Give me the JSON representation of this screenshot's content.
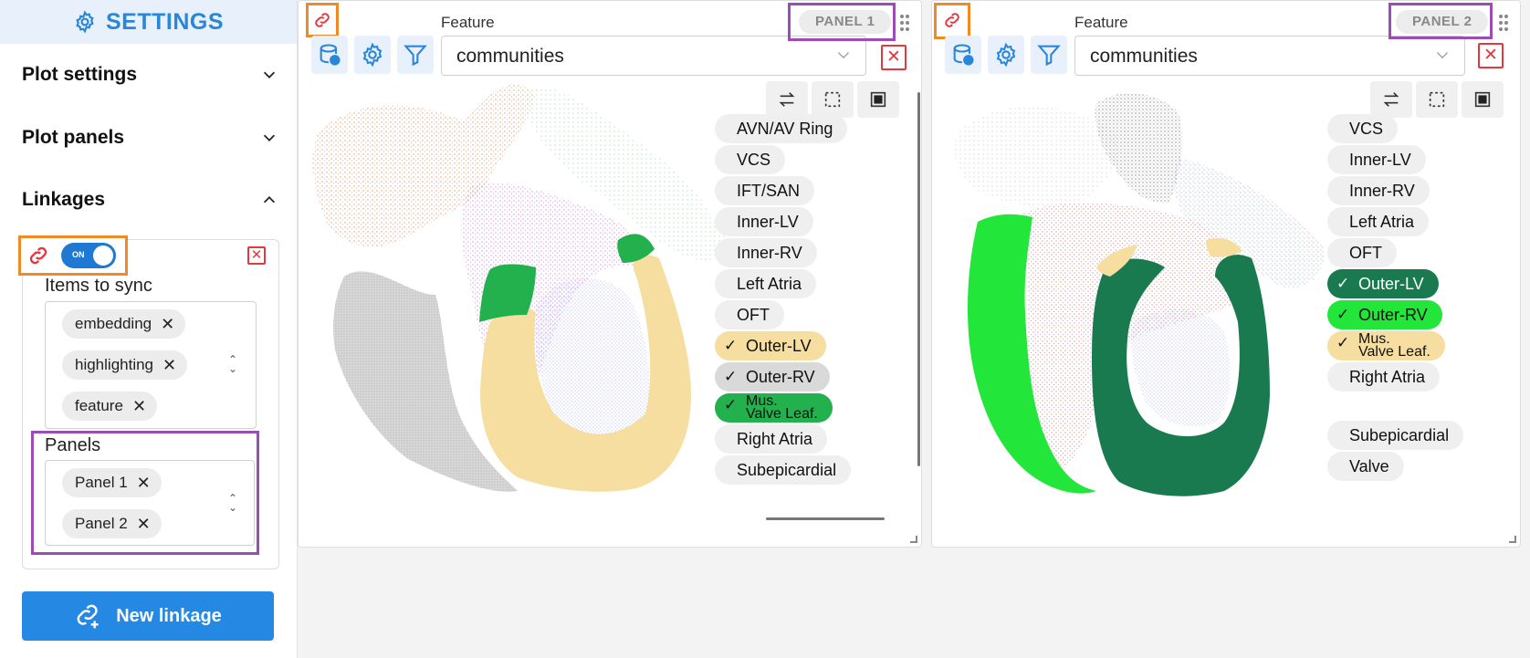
{
  "sidebar": {
    "title": "SETTINGS",
    "sections": [
      {
        "label": "Plot settings",
        "expanded": false
      },
      {
        "label": "Plot panels",
        "expanded": false
      },
      {
        "label": "Linkages",
        "expanded": true
      }
    ],
    "linkage": {
      "toggle_label": "ON",
      "items_label": "Items to sync",
      "items": [
        "embedding",
        "highlighting",
        "feature"
      ],
      "panels_label": "Panels",
      "panels": [
        "Panel 1",
        "Panel 2"
      ]
    },
    "new_linkage_label": "New linkage"
  },
  "panels": [
    {
      "tag": "PANEL 1",
      "feature_label": "Feature",
      "feature_value": "communities",
      "legend": [
        {
          "label": "AVN/AV Ring",
          "checked": false
        },
        {
          "label": "VCS",
          "checked": false
        },
        {
          "label": "IFT/SAN",
          "checked": false
        },
        {
          "label": "Inner-LV",
          "checked": false
        },
        {
          "label": "Inner-RV",
          "checked": false
        },
        {
          "label": "Left Atria",
          "checked": false
        },
        {
          "label": "OFT",
          "checked": false
        },
        {
          "label": "Outer-LV",
          "checked": true,
          "color": "#f5dea0"
        },
        {
          "label": "Outer-RV",
          "checked": true,
          "color": "#d9d9d9"
        },
        {
          "label": "Mus.\nValve Leaf.",
          "checked": true,
          "color": "#22b14c"
        },
        {
          "label": "Right Atria",
          "checked": false
        },
        {
          "label": "Subepicardial",
          "checked": false
        }
      ]
    },
    {
      "tag": "PANEL 2",
      "feature_label": "Feature",
      "feature_value": "communities",
      "legend": [
        {
          "label": "VCS",
          "checked": false
        },
        {
          "label": "Inner-LV",
          "checked": false
        },
        {
          "label": "Inner-RV",
          "checked": false
        },
        {
          "label": "Left Atria",
          "checked": false
        },
        {
          "label": "OFT",
          "checked": false
        },
        {
          "label": "Outer-LV",
          "checked": true,
          "color": "#1a7a4f"
        },
        {
          "label": "Outer-RV",
          "checked": true,
          "color": "#22e63a"
        },
        {
          "label": "Mus.\nValve Leaf.",
          "checked": true,
          "color": "#f5dea0"
        },
        {
          "label": "Right Atria",
          "checked": false
        },
        {
          "label": "Subepicardial",
          "checked": false
        },
        {
          "label": "Valve",
          "checked": false
        }
      ]
    }
  ],
  "colors": {
    "accent": "#2588e3",
    "highlight_orange": "#f08a24",
    "highlight_purple": "#9b4db5",
    "danger": "#e0393e"
  }
}
